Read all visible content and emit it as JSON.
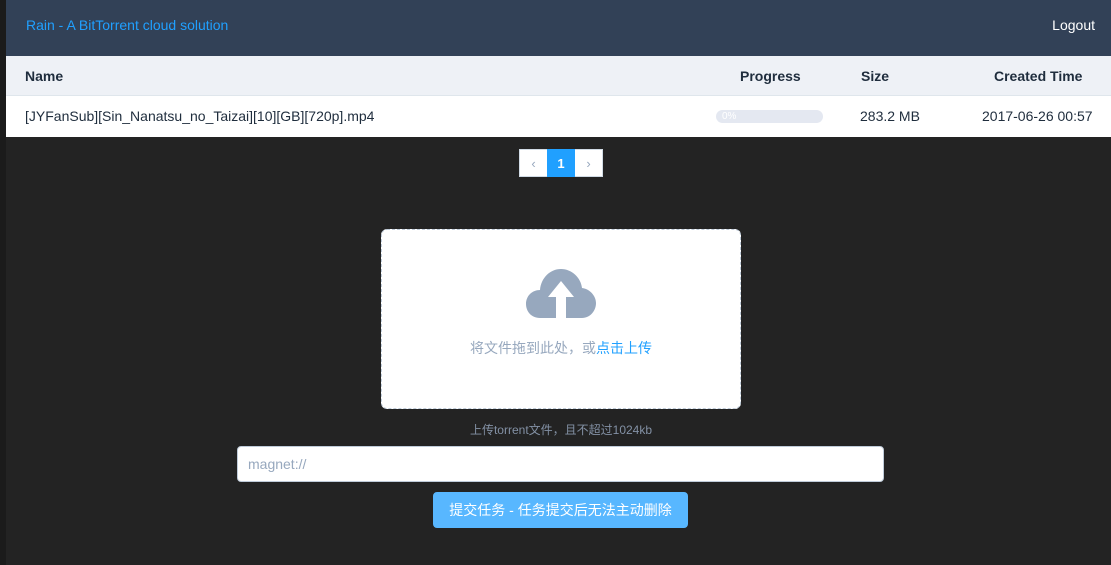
{
  "header": {
    "title": "Rain - A BitTorrent cloud solution",
    "logout_label": "Logout"
  },
  "table": {
    "columns": {
      "name": "Name",
      "progress": "Progress",
      "size": "Size",
      "created": "Created Time"
    },
    "rows": [
      {
        "name": "[JYFanSub][Sin_Nanatsu_no_Taizai][10][GB][720p].mp4",
        "progress_text": "0%",
        "progress_fraction": 0,
        "size": "283.2 MB",
        "created": "2017-06-26 00:57"
      }
    ]
  },
  "pagination": {
    "prev_icon": "‹",
    "current_page": "1",
    "next_icon": "›"
  },
  "upload": {
    "icon": "cloud-upload-icon",
    "text_prefix": "将文件拖到此处，或",
    "text_link": "点击上传",
    "tip": "上传torrent文件，且不超过1024kb"
  },
  "magnet": {
    "value": "",
    "placeholder": "magnet://"
  },
  "submit_label": "提交任务 - 任务提交后无法主动删除",
  "colors": {
    "header_bg": "#324157",
    "accent": "#20a0ff",
    "submit_bg": "#58b7ff",
    "page_bg": "#232323"
  }
}
